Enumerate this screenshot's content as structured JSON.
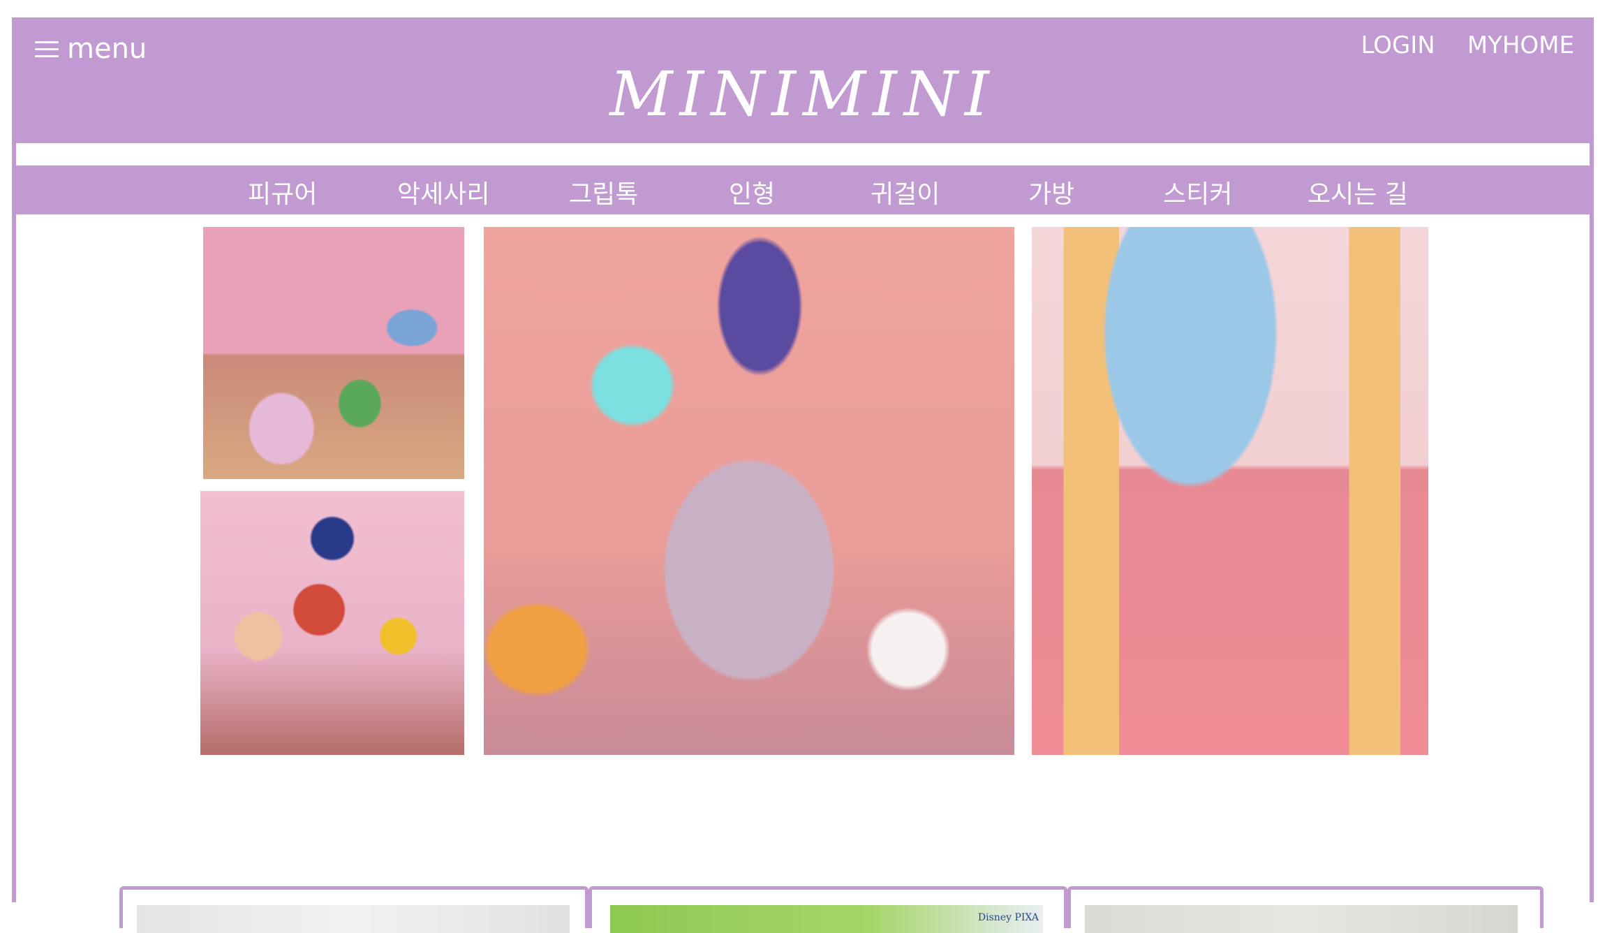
{
  "header": {
    "menu_label": "menu",
    "logo": "MINIMINI",
    "links": [
      "LOGIN",
      "MYHOME"
    ]
  },
  "nav": {
    "items": [
      "피규어",
      "악세사리",
      "그립톡",
      "인형",
      "귀걸이",
      "가방",
      "스티커",
      "오시는 길"
    ]
  },
  "gallery": {
    "photos": [
      {
        "alt": "toy shop desk photo"
      },
      {
        "alt": "retro shelf photo"
      },
      {
        "alt": "pink room with sofa photo"
      },
      {
        "alt": "storefront window photo"
      }
    ]
  },
  "cards": {
    "items": [
      {
        "thumb_text": ""
      },
      {
        "thumb_text": "Disney PIXA"
      },
      {
        "thumb_text": ""
      }
    ]
  },
  "colors": {
    "accent": "#c09ad0",
    "text_on_accent": "#ffffff"
  }
}
